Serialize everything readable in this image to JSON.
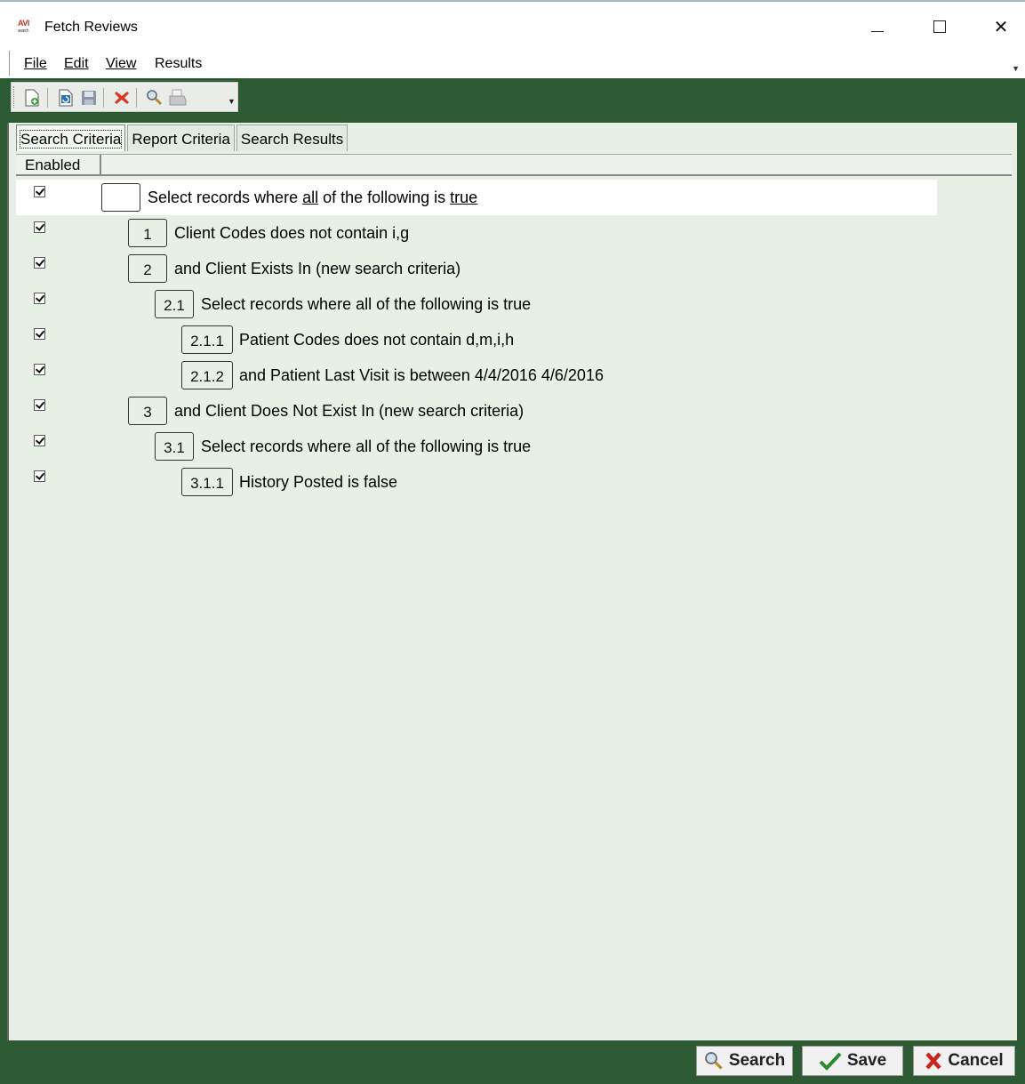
{
  "window": {
    "title": "Fetch Reviews",
    "logo_text": "AVI",
    "logo_sub": "search"
  },
  "menu": {
    "file": "File",
    "edit": "Edit",
    "view": "View",
    "results": "Results"
  },
  "toolbar": {
    "icons": [
      "new-icon",
      "refresh-icon",
      "save-icon",
      "delete-icon",
      "search-icon",
      "print-icon"
    ]
  },
  "tabs": [
    {
      "label": "Search Criteria",
      "active": true
    },
    {
      "label": "Report Criteria",
      "active": false
    },
    {
      "label": "Search Results",
      "active": false
    }
  ],
  "grid": {
    "column_header": "Enabled",
    "rows": [
      {
        "number": "",
        "prefix": "Select records where ",
        "u1": "all",
        "mid": " of the following is ",
        "u2": "true",
        "enabled": true
      },
      {
        "number": "1",
        "text": "Client Codes does not contain i,g",
        "enabled": true
      },
      {
        "number": "2",
        "text": "and Client Exists In (new search criteria)",
        "enabled": true
      },
      {
        "number": "2.1",
        "text": "Select records where all of the following is true",
        "enabled": true
      },
      {
        "number": "2.1.1",
        "text": "Patient Codes does not contain d,m,i,h",
        "enabled": true
      },
      {
        "number": "2.1.2",
        "text": "and Patient Last Visit is between 4/4/2016 4/6/2016",
        "enabled": true
      },
      {
        "number": "3",
        "text": "and Client Does Not Exist In (new search criteria)",
        "enabled": true
      },
      {
        "number": "3.1",
        "text": "Select records where all of the following is true",
        "enabled": true
      },
      {
        "number": "3.1.1",
        "text": "History Posted is false",
        "enabled": true
      }
    ]
  },
  "buttons": {
    "search": "Search",
    "save": "Save",
    "cancel": "Cancel"
  },
  "colors": {
    "frame": "#2d5a33",
    "panel": "#e8f0e6"
  }
}
